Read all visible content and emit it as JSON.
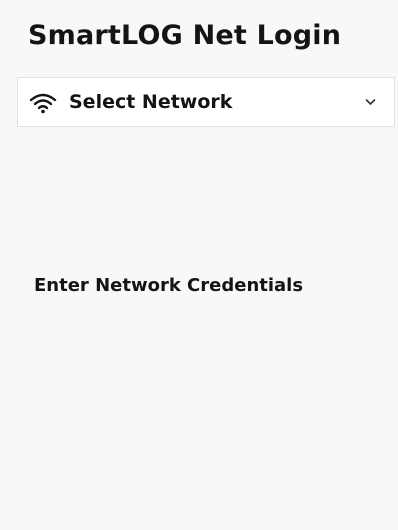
{
  "page": {
    "title": "SmartLOG Net Login"
  },
  "network_select": {
    "icon": "wifi-icon",
    "label": "Select Network",
    "chevron": "chevron-down-icon"
  },
  "credentials": {
    "heading": "Enter Network Credentials"
  }
}
